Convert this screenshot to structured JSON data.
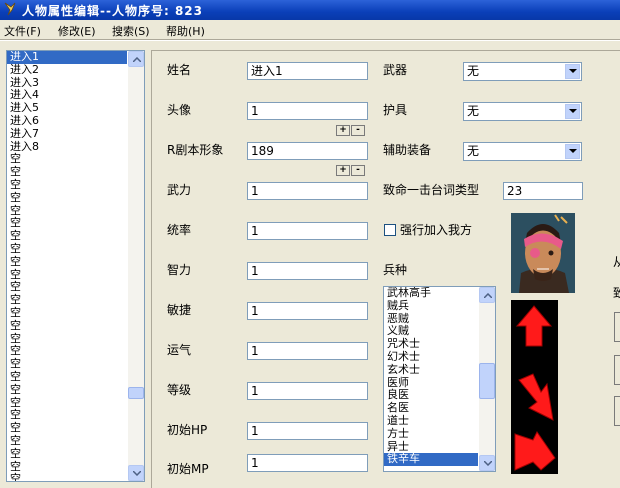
{
  "window": {
    "title": "人物属性编辑--人物序号: 823"
  },
  "menu": [
    "文件(F)",
    "修改(E)",
    "搜索(S)",
    "帮助(H)"
  ],
  "left_list": {
    "items": [
      "进入1",
      "进入2",
      "进入3",
      "进入4",
      "进入5",
      "进入6",
      "进入7",
      "进入8",
      "空",
      "空",
      "空",
      "空",
      "空",
      "空",
      "空",
      "空",
      "空",
      "空",
      "空",
      "空",
      "空",
      "空",
      "空",
      "空",
      "空",
      "空",
      "空",
      "空",
      "空",
      "空",
      "空",
      "空",
      "空",
      "空"
    ],
    "selected_index": 0
  },
  "fields": {
    "name": {
      "label": "姓名",
      "value": "进入1"
    },
    "head": {
      "label": "头像",
      "value": "1"
    },
    "r_image": {
      "label": "R剧本形象",
      "value": "189"
    },
    "force": {
      "label": "武力",
      "value": "1"
    },
    "command": {
      "label": "统率",
      "value": "1"
    },
    "intel": {
      "label": "智力",
      "value": "1"
    },
    "agility": {
      "label": "敏捷",
      "value": "1"
    },
    "luck": {
      "label": "运气",
      "value": "1"
    },
    "level": {
      "label": "等级",
      "value": "1"
    },
    "hp": {
      "label": "初始HP",
      "value": "1"
    },
    "mp": {
      "label": "初始MP",
      "value": "1"
    }
  },
  "spinners": {
    "plus": "+",
    "minus": "-"
  },
  "right": {
    "weapon": {
      "label": "武器",
      "value": "无"
    },
    "armor": {
      "label": "护具",
      "value": "无"
    },
    "accessory": {
      "label": "辅助装备",
      "value": "无"
    },
    "critical": {
      "label": "致命一击台词类型",
      "value": "23"
    },
    "force_join": {
      "label": "强行加入我方",
      "checked": false
    },
    "unit_type": {
      "label": "兵种"
    }
  },
  "unit_list": {
    "items": [
      "武林高手",
      "贼兵",
      "恶贼",
      "义贼",
      "咒术士",
      "幻术士",
      "玄术士",
      "医师",
      "良医",
      "名医",
      "道士",
      "方士",
      "异士",
      "铁辛车"
    ],
    "selected_index": 13
  },
  "cut_text": {
    "a": "从",
    "b": "致"
  },
  "colors": {
    "title_bar": "#0a3fb8",
    "selection": "#316ac5",
    "arrow": "#ff1a1a"
  }
}
